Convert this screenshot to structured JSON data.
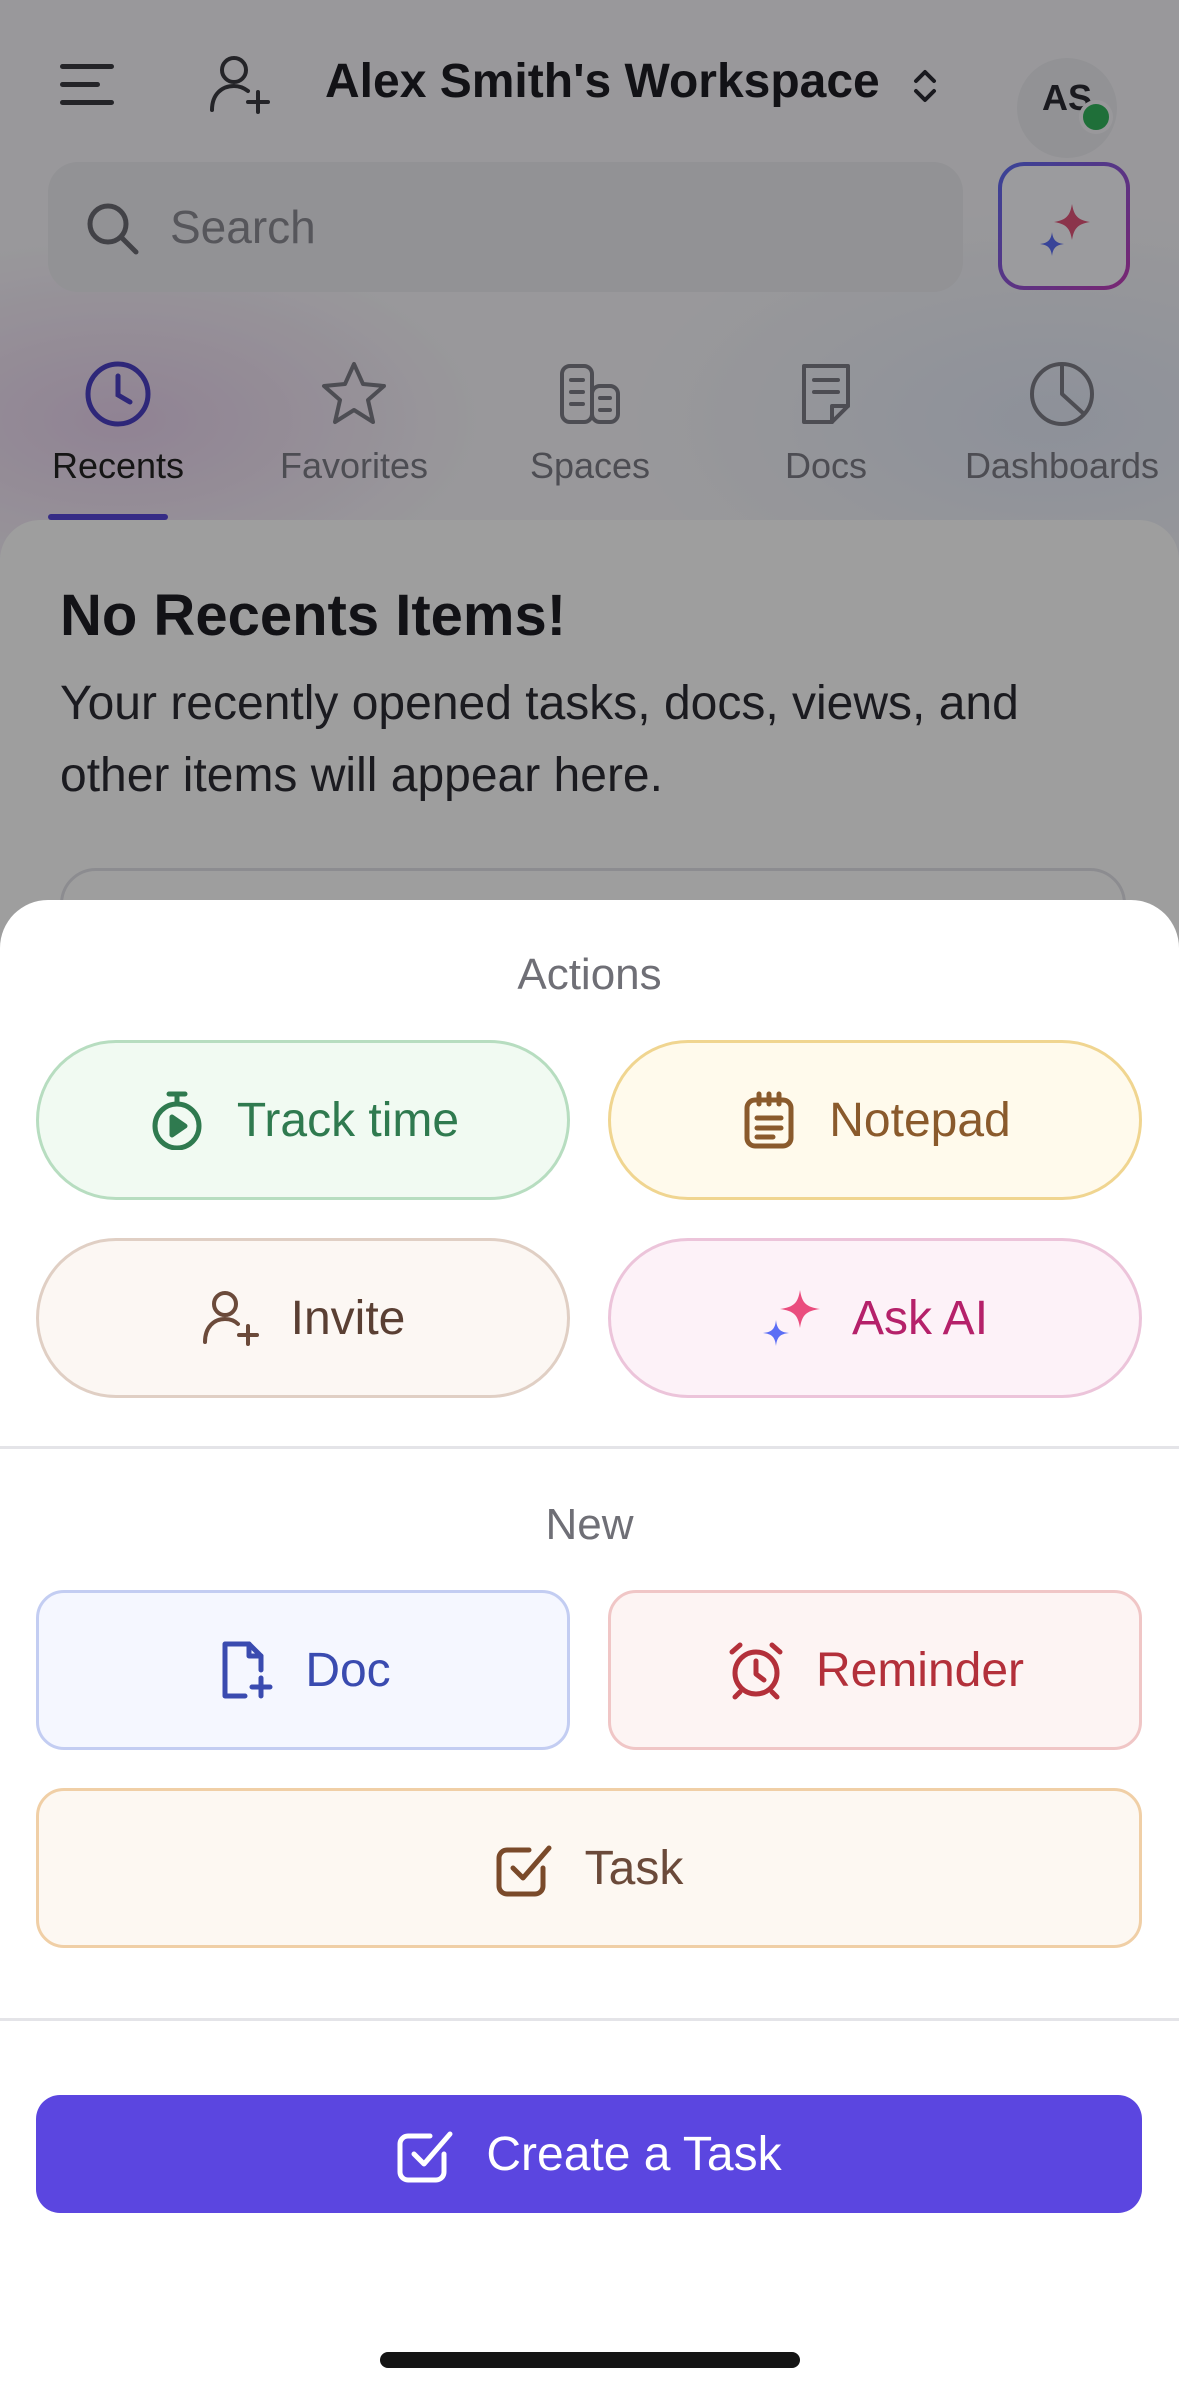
{
  "header": {
    "workspace_title": "Alex Smith's Workspace",
    "avatar_initials": "AS",
    "search_placeholder": "Search"
  },
  "tabs": [
    {
      "label": "Recents",
      "icon": "clock-icon",
      "active": true
    },
    {
      "label": "Favorites",
      "icon": "star-icon",
      "active": false
    },
    {
      "label": "Spaces",
      "icon": "spaces-icon",
      "active": false
    },
    {
      "label": "Docs",
      "icon": "doc-icon",
      "active": false
    },
    {
      "label": "Dashboards",
      "icon": "pie-chart-icon",
      "active": false
    }
  ],
  "recents": {
    "title": "No Recents Items!",
    "description": "Your recently opened tasks, docs, views, and other items will appear here."
  },
  "sheet": {
    "actions_title": "Actions",
    "actions": [
      {
        "label": "Track time",
        "icon": "stopwatch-icon"
      },
      {
        "label": "Notepad",
        "icon": "notepad-icon"
      },
      {
        "label": "Invite",
        "icon": "add-user-icon"
      },
      {
        "label": "Ask AI",
        "icon": "sparkle-icon"
      }
    ],
    "new_title": "New",
    "new_items": [
      {
        "label": "Doc",
        "icon": "doc-add-icon"
      },
      {
        "label": "Reminder",
        "icon": "alarm-clock-icon"
      },
      {
        "label": "Task",
        "icon": "checkbox-icon"
      }
    ],
    "primary_label": "Create a Task"
  },
  "colors": {
    "accent": "#5b46e0",
    "track_time": "#2f7a4f",
    "notepad": "#8a5a2c",
    "invite": "#6b4a3a",
    "ask_ai": "#b5216a",
    "doc": "#3a4bb0",
    "reminder": "#b3303a",
    "task": "#7a4a2a"
  }
}
